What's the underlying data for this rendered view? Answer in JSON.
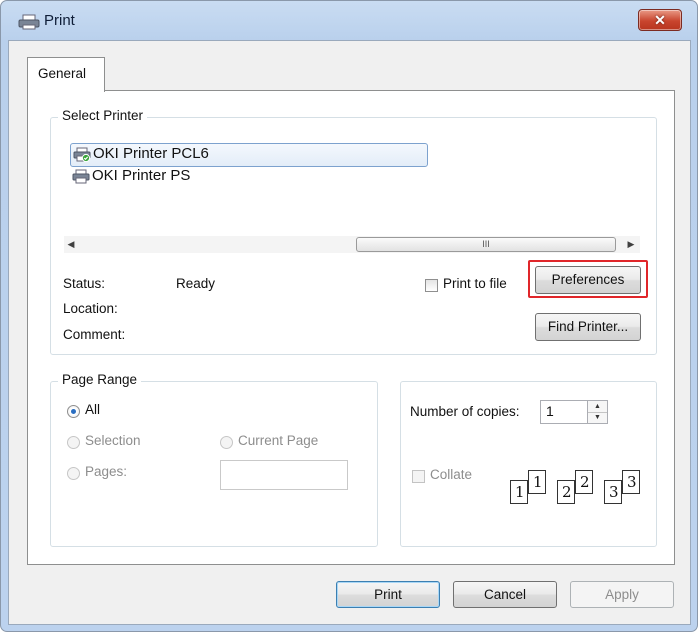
{
  "window": {
    "title": "Print",
    "icons": {
      "title": "printer-icon",
      "close": "close-x-icon"
    },
    "colors": {
      "close_button": "#c9452e",
      "highlight": "#e0262a",
      "radio_selected": "#2a6ec1"
    }
  },
  "tabs": [
    {
      "label": "General",
      "selected": true
    }
  ],
  "select_printer": {
    "group_label": "Select Printer",
    "printers": [
      {
        "name": "OKI Printer PCL6",
        "selected": true,
        "default": true
      },
      {
        "name": "OKI Printer PS",
        "selected": false,
        "default": false
      }
    ],
    "scroll_grip": "III",
    "status_label": "Status:",
    "status_value": "Ready",
    "location_label": "Location:",
    "location_value": "",
    "comment_label": "Comment:",
    "comment_value": "",
    "print_to_file_label": "Print to file",
    "print_to_file_checked": false,
    "preferences_label": "Preferences",
    "find_printer_label": "Find Printer..."
  },
  "page_range": {
    "group_label": "Page Range",
    "all_label": "All",
    "selection_label": "Selection",
    "current_page_label": "Current Page",
    "pages_label": "Pages:",
    "pages_value": "",
    "selected": "All"
  },
  "copies": {
    "label": "Number of copies:",
    "value": "1",
    "collate_label": "Collate",
    "collate_checked": false,
    "collate_numbers": [
      "1",
      "1",
      "2",
      "2",
      "3",
      "3"
    ]
  },
  "footer": {
    "print_label": "Print",
    "cancel_label": "Cancel",
    "apply_label": "Apply"
  }
}
